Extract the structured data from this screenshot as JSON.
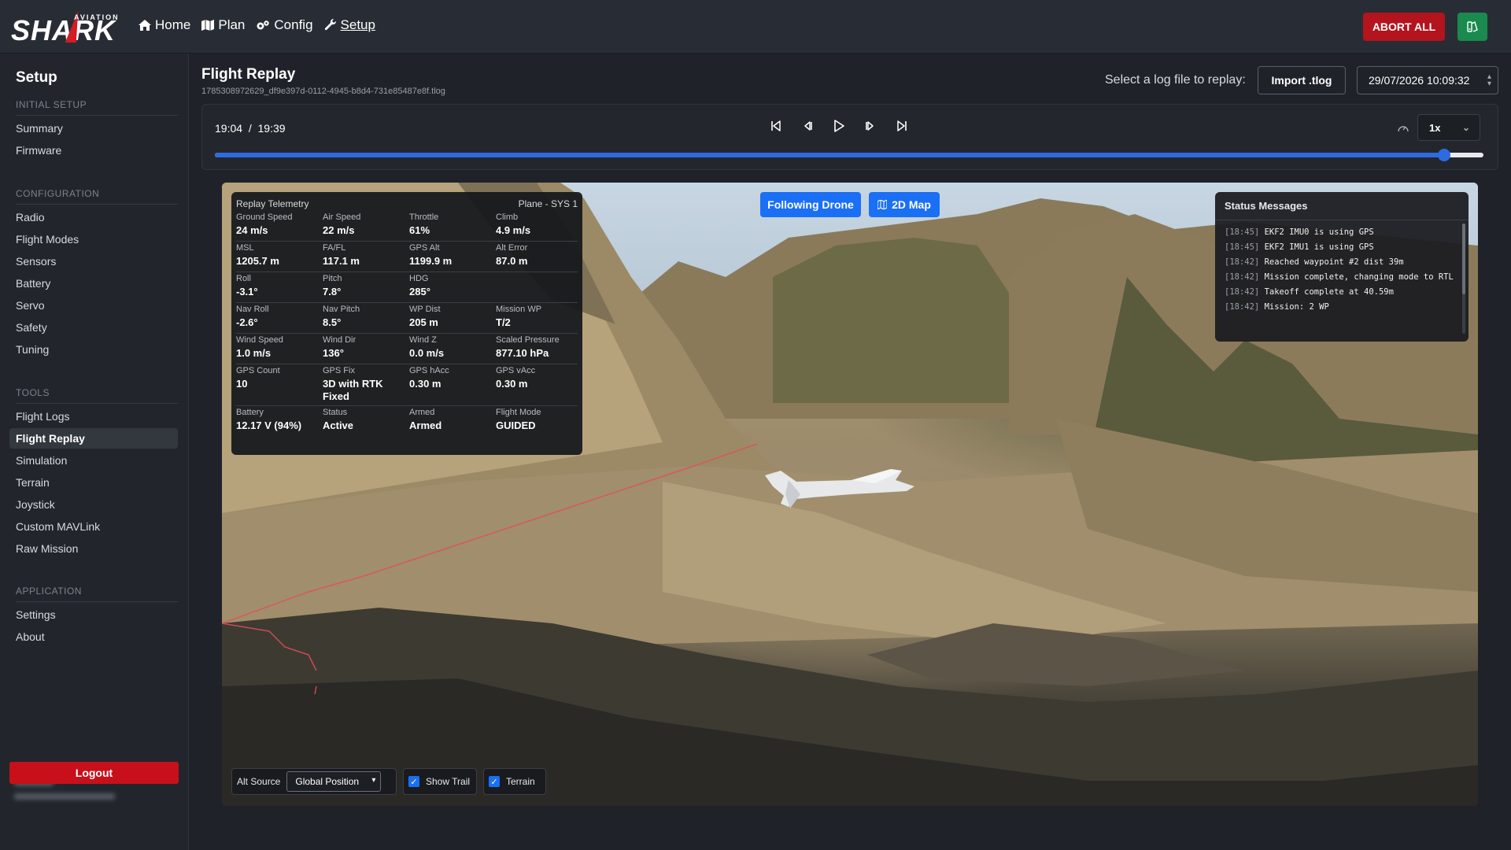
{
  "brand": {
    "logo_text": "SHARK",
    "logo_subtext": "AVIATION"
  },
  "nav": [
    {
      "label": "Home",
      "icon": "home-icon"
    },
    {
      "label": "Plan",
      "icon": "map-icon"
    },
    {
      "label": "Config",
      "icon": "gears-icon"
    },
    {
      "label": "Setup",
      "icon": "wrench-icon"
    }
  ],
  "header": {
    "abort_label": "ABORT ALL",
    "theme_icon": "palette-icon"
  },
  "sidebar": {
    "title": "Setup",
    "sections": [
      {
        "title": "INITIAL SETUP",
        "items": [
          "Summary",
          "Firmware"
        ]
      },
      {
        "title": "CONFIGURATION",
        "items": [
          "Radio",
          "Flight Modes",
          "Sensors",
          "Battery",
          "Servo",
          "Safety",
          "Tuning"
        ]
      },
      {
        "title": "TOOLS",
        "items": [
          "Flight Logs",
          "Flight Replay",
          "Simulation",
          "Terrain",
          "Joystick",
          "Custom MAVLink",
          "Raw Mission"
        ]
      },
      {
        "title": "APPLICATION",
        "items": [
          "Settings",
          "About"
        ]
      }
    ],
    "active_item": "Flight Replay",
    "logout_label": "Logout"
  },
  "page": {
    "title": "Flight Replay",
    "filename": "1785308972629_df9e397d-0112-4945-b8d4-731e85487e8f.tlog",
    "select_label": "Select a log file to replay:",
    "import_label": "Import .tlog",
    "selected_log": "29/07/2026 10:09:32"
  },
  "playback": {
    "current_time": "19:04",
    "separator": "/",
    "total_time": "19:39",
    "speed": "1x",
    "progress": 0.969
  },
  "view": {
    "follow_label": "Following Drone",
    "map2d_label": "2D Map",
    "telemetry": {
      "title": "Replay Telemetry",
      "vehicle": "Plane - SYS 1",
      "rows": [
        [
          {
            "label": "Ground Speed",
            "value": "24 m/s"
          },
          {
            "label": "Air Speed",
            "value": "22 m/s"
          },
          {
            "label": "Throttle",
            "value": "61%"
          },
          {
            "label": "Climb",
            "value": "4.9 m/s"
          }
        ],
        [
          {
            "label": "MSL",
            "value": "1205.7 m"
          },
          {
            "label": "FA/FL",
            "value": "117.1 m"
          },
          {
            "label": "GPS Alt",
            "value": "1199.9 m"
          },
          {
            "label": "Alt Error",
            "value": "87.0 m"
          }
        ],
        [
          {
            "label": "Roll",
            "value": "-3.1°"
          },
          {
            "label": "Pitch",
            "value": "7.8°"
          },
          {
            "label": "HDG",
            "value": "285°"
          },
          {
            "label": "",
            "value": ""
          }
        ],
        [
          {
            "label": "Nav Roll",
            "value": "-2.6°"
          },
          {
            "label": "Nav Pitch",
            "value": "8.5°"
          },
          {
            "label": "WP Dist",
            "value": "205 m"
          },
          {
            "label": "Mission WP",
            "value": "T/2"
          }
        ],
        [
          {
            "label": "Wind Speed",
            "value": "1.0 m/s"
          },
          {
            "label": "Wind Dir",
            "value": "136°"
          },
          {
            "label": "Wind Z",
            "value": "0.0 m/s"
          },
          {
            "label": "Scaled Pressure",
            "value": "877.10 hPa"
          }
        ],
        [
          {
            "label": "GPS Count",
            "value": "10"
          },
          {
            "label": "GPS Fix",
            "value": "3D with RTK Fixed"
          },
          {
            "label": "GPS hAcc",
            "value": "0.30 m"
          },
          {
            "label": "GPS vAcc",
            "value": "0.30 m"
          }
        ],
        [
          {
            "label": "Battery",
            "value": "12.17 V (94%)"
          },
          {
            "label": "Status",
            "value": "Active"
          },
          {
            "label": "Armed",
            "value": "Armed"
          },
          {
            "label": "Flight Mode",
            "value": "GUIDED"
          }
        ]
      ]
    },
    "status": {
      "title": "Status Messages",
      "messages": [
        {
          "time": "[18:45]",
          "text": "EKF2 IMU0 is using GPS"
        },
        {
          "time": "[18:45]",
          "text": "EKF2 IMU1 is using GPS"
        },
        {
          "time": "[18:42]",
          "text": "Reached waypoint #2 dist 39m"
        },
        {
          "time": "[18:42]",
          "text": "Mission complete, changing mode to RTL"
        },
        {
          "time": "[18:42]",
          "text": "Takeoff complete at 40.59m"
        },
        {
          "time": "[18:42]",
          "text": "Mission: 2 WP"
        }
      ]
    },
    "alt_source_label": "Alt Source",
    "alt_source_value": "Global Position",
    "show_trail_label": "Show Trail",
    "terrain_label": "Terrain",
    "show_trail_checked": true,
    "terrain_checked": true
  },
  "colors": {
    "accent": "#1a6ff5",
    "abort": "#b3141d",
    "logout": "#c8101a",
    "trail": "#e0505a"
  }
}
